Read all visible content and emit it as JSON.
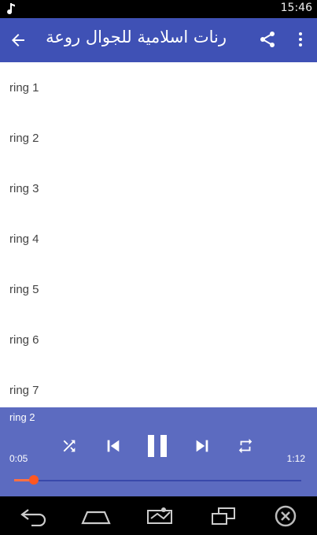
{
  "status_bar": {
    "time": "15:46",
    "icons": [
      "music-note-icon"
    ]
  },
  "app_bar": {
    "title": "رنات اسلامية للجوال روعة",
    "icons": [
      "arrow-back-icon",
      "share-icon",
      "more-vert-icon"
    ]
  },
  "list": {
    "items": [
      {
        "label": "ring 1"
      },
      {
        "label": "ring 2"
      },
      {
        "label": "ring 3"
      },
      {
        "label": "ring 4"
      },
      {
        "label": "ring 5"
      },
      {
        "label": "ring 6"
      },
      {
        "label": "ring 7"
      }
    ]
  },
  "player": {
    "now_playing": "ring 2",
    "current_time": "0:05",
    "total_time": "1:12",
    "progress": 0.069,
    "icons": [
      "shuffle-icon",
      "skip-previous-icon",
      "pause-icon",
      "skip-next-icon",
      "repeat-icon"
    ]
  },
  "nav_bar": {
    "icons": [
      "back-icon",
      "home-icon",
      "recents-icon",
      "screenshot-icon",
      "close-icon"
    ]
  },
  "colors": {
    "app_bar": "#3f51b5",
    "player": "#5c6bc0",
    "accent": "#ff5722"
  }
}
